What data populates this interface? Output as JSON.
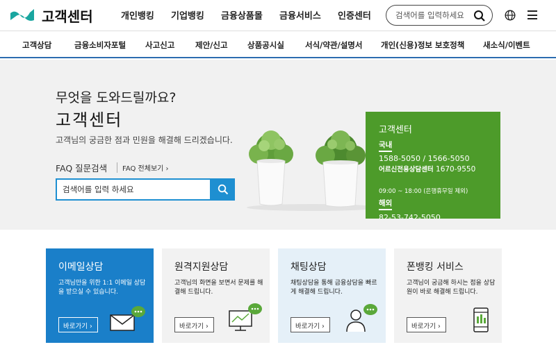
{
  "header": {
    "logo_text": "고객센터",
    "gnb": [
      "개인뱅킹",
      "기업뱅킹",
      "금융상품몰",
      "금융서비스",
      "인증센터"
    ],
    "search_placeholder": "검색어를 입력하세요"
  },
  "subnav": [
    "고객상담",
    "금융소비자포털",
    "사고신고",
    "제안/신고",
    "상품공시실",
    "서식/약관/설명서",
    "개인(신용)정보 보호정책",
    "새소식/이벤트"
  ],
  "hero": {
    "question": "무엇을 도와드릴까요?",
    "title": "고객센터",
    "description": "고객님의 궁금한 점과 민원을 해결해 드리겠습니다.",
    "faq_label": "FAQ 질문검색",
    "faq_all_link": "FAQ 전체보기 ›",
    "search_placeholder": "검색어를 입력 하세요"
  },
  "contact": {
    "title": "고객센터",
    "domestic_label": "국내",
    "domestic_numbers": "1588-5050 / 1566-5050",
    "senior_label": "어르신전용상담센터",
    "senior_number": "1670-9550",
    "hours": "09:00 ~ 18:00 (은행휴무일 제외)",
    "intl_label": "해외",
    "intl_number": "82-53-742-5050"
  },
  "cards": [
    {
      "title": "이메일상담",
      "desc": "고객님만을 위한 1:1 이메일 상담을 받으실 수 있습니다.",
      "button": "바로가기 ›",
      "icon": "email-chat-icon"
    },
    {
      "title": "원격지원상담",
      "desc": "고객님의 화면을 보면서 문제를 해결해 드립니다.",
      "button": "바로가기 ›",
      "icon": "monitor-chat-icon"
    },
    {
      "title": "채팅상담",
      "desc": "채팅상담을 통해 금융상담을 빠르게 해결해 드립니다.",
      "button": "바로가기 ›",
      "icon": "person-chat-icon"
    },
    {
      "title": "폰뱅킹 서비스",
      "desc": "고객님이 궁금해 하시는 점을 상담원이 바로 해결해 드립니다.",
      "button": "바로가기 ›",
      "icon": "phone-icon"
    }
  ],
  "colors": {
    "brand_green": "#4d9b2a",
    "brand_blue": "#1e8fd1",
    "logo_teal": "#1aa6a0"
  }
}
